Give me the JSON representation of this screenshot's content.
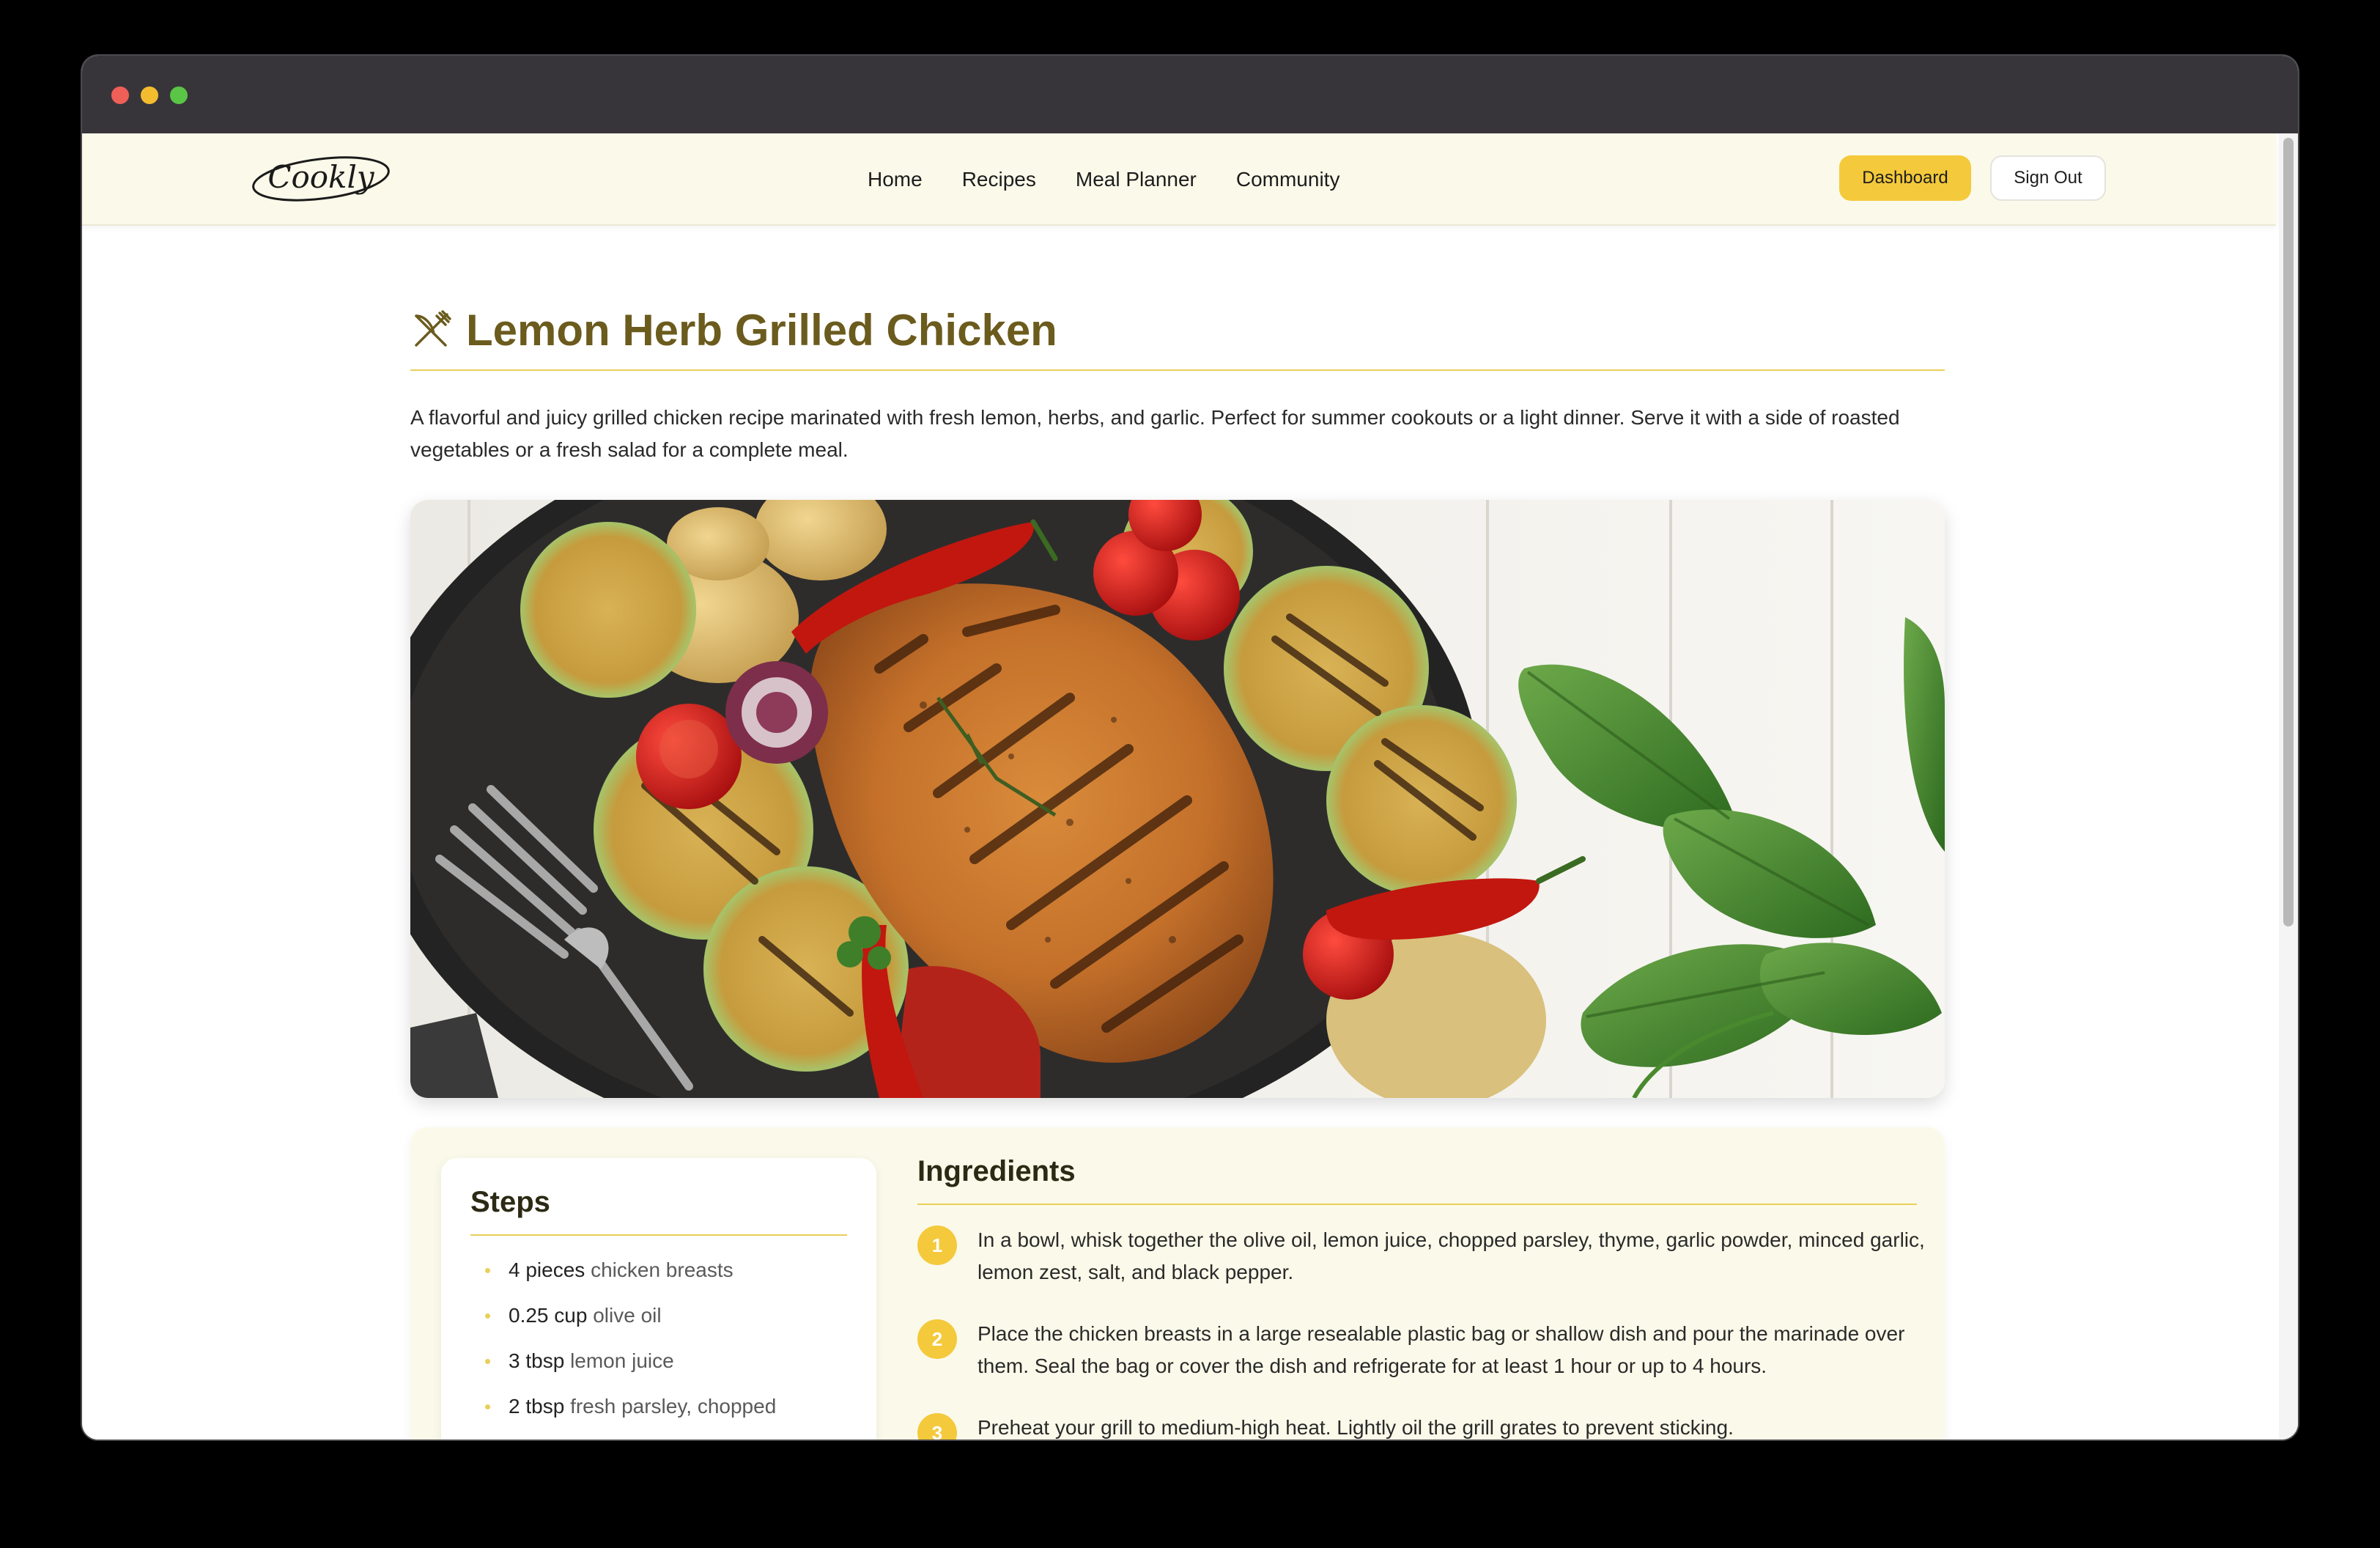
{
  "window": {
    "traffic_lights": [
      "close",
      "minimize",
      "zoom"
    ]
  },
  "navbar": {
    "logo_text": "Cookly",
    "links": [
      "Home",
      "Recipes",
      "Meal Planner",
      "Community"
    ],
    "dashboard_label": "Dashboard",
    "signout_label": "Sign Out"
  },
  "recipe": {
    "title_icon": "utensils-crossed-icon",
    "title": "Lemon Herb Grilled Chicken",
    "description": "A flavorful and juicy grilled chicken recipe marinated with fresh lemon, herbs, and garlic. Perfect for summer cookouts or a light dinner. Serve it with a side of roasted vegetables or a fresh salad for a complete meal.",
    "image_subject": "grilled chicken breast with grilled zucchini, potatoes, tomatoes, peppers and basil"
  },
  "steps_card": {
    "title": "Steps",
    "items": [
      {
        "qty": "4 pieces",
        "name": "chicken breasts"
      },
      {
        "qty": "0.25 cup",
        "name": "olive oil"
      },
      {
        "qty": "3 tbsp",
        "name": "lemon juice"
      },
      {
        "qty": "2 tbsp",
        "name": "fresh parsley, chopped"
      }
    ]
  },
  "ingredients_panel": {
    "title": "Ingredients",
    "steps": [
      {
        "number": "1",
        "text": "In a bowl, whisk together the olive oil, lemon juice, chopped parsley, thyme, garlic powder, minced garlic, lemon zest, salt, and black pepper."
      },
      {
        "number": "2",
        "text": "Place the chicken breasts in a large resealable plastic bag or shallow dish and pour the marinade over them. Seal the bag or cover the dish and refrigerate for at least 1 hour or up to 4 hours."
      },
      {
        "number": "3",
        "text": "Preheat your grill to medium-high heat. Lightly oil the grill grates to prevent sticking."
      }
    ]
  },
  "colors": {
    "accent": "#f4c93b",
    "title": "#6b5b1d",
    "navbar_bg": "#fbfaea",
    "rule": "#e9cf58"
  }
}
